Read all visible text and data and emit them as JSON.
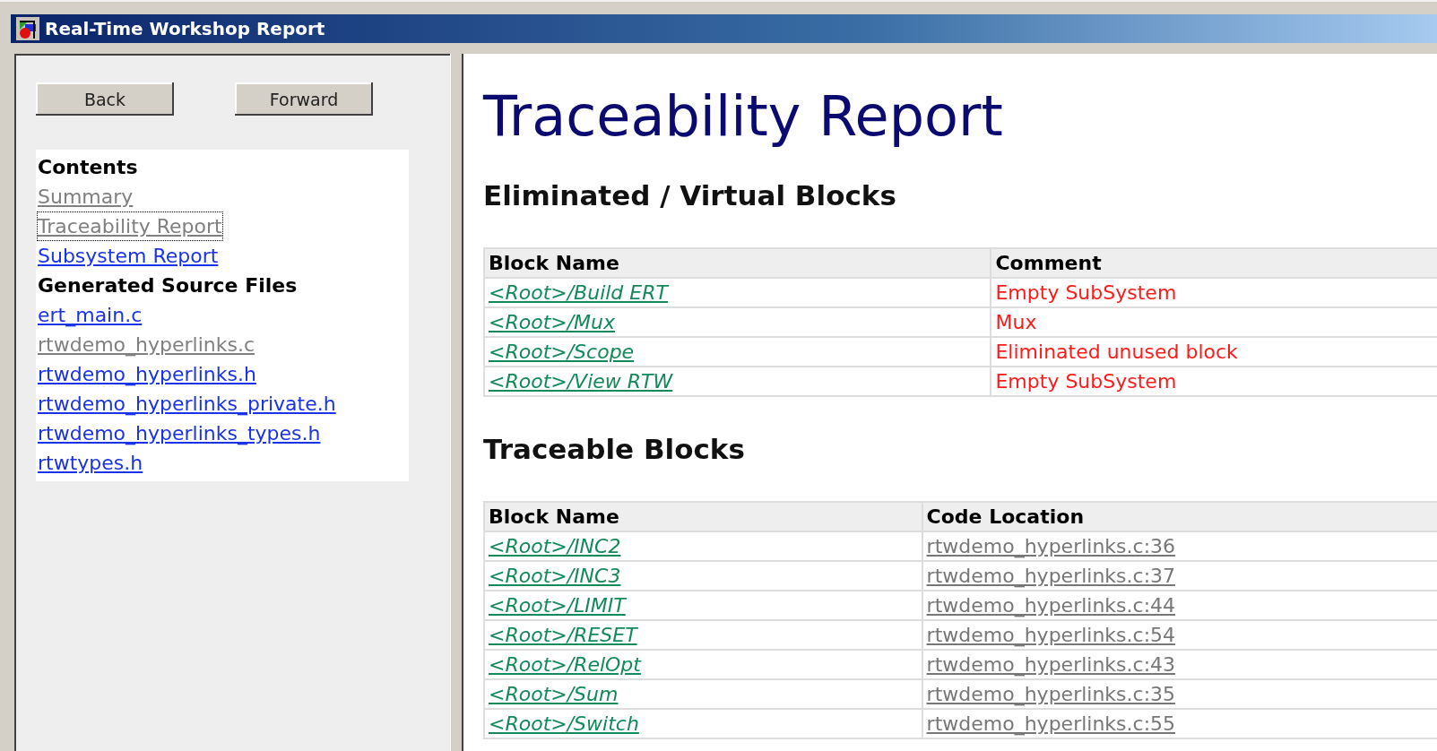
{
  "window": {
    "title": "Real-Time Workshop Report"
  },
  "nav_buttons": [
    "Back",
    "Forward"
  ],
  "contents": [
    {
      "kind": "heading",
      "text": "Contents"
    },
    {
      "kind": "link",
      "text": "Summary",
      "visited": true,
      "focused": false
    },
    {
      "kind": "link",
      "text": "Traceability Report",
      "visited": true,
      "focused": true
    },
    {
      "kind": "link",
      "text": "Subsystem Report",
      "visited": false,
      "focused": false
    },
    {
      "kind": "heading",
      "text": "Generated Source Files"
    },
    {
      "kind": "link",
      "text": "ert_main.c",
      "visited": false,
      "focused": false
    },
    {
      "kind": "link",
      "text": "rtwdemo_hyperlinks.c",
      "visited": true,
      "focused": false
    },
    {
      "kind": "link",
      "text": "rtwdemo_hyperlinks.h",
      "visited": false,
      "focused": false
    },
    {
      "kind": "link",
      "text": "rtwdemo_hyperlinks_private.h",
      "visited": false,
      "focused": false
    },
    {
      "kind": "link",
      "text": "rtwdemo_hyperlinks_types.h",
      "visited": false,
      "focused": false
    },
    {
      "kind": "link",
      "text": "rtwtypes.h",
      "visited": false,
      "focused": false
    }
  ],
  "report": {
    "title": "Traceability Report",
    "sections": [
      {
        "heading": "Eliminated / Virtual Blocks",
        "kind": "comment",
        "columns": [
          "Block Name",
          "Comment"
        ],
        "rows": [
          [
            "<Root>/Build ERT",
            "Empty SubSystem"
          ],
          [
            "<Root>/Mux",
            "Mux"
          ],
          [
            "<Root>/Scope",
            "Eliminated unused block"
          ],
          [
            "<Root>/View RTW",
            "Empty SubSystem"
          ]
        ]
      },
      {
        "heading": "Traceable Blocks",
        "kind": "location",
        "columns": [
          "Block Name",
          "Code Location"
        ],
        "rows": [
          [
            "<Root>/INC2",
            "rtwdemo_hyperlinks.c:36"
          ],
          [
            "<Root>/INC3",
            "rtwdemo_hyperlinks.c:37"
          ],
          [
            "<Root>/LIMIT",
            "rtwdemo_hyperlinks.c:44"
          ],
          [
            "<Root>/RESET",
            "rtwdemo_hyperlinks.c:54"
          ],
          [
            "<Root>/RelOpt",
            "rtwdemo_hyperlinks.c:43"
          ],
          [
            "<Root>/Sum",
            "rtwdemo_hyperlinks.c:35"
          ],
          [
            "<Root>/Switch",
            "rtwdemo_hyperlinks.c:55"
          ]
        ]
      }
    ]
  }
}
